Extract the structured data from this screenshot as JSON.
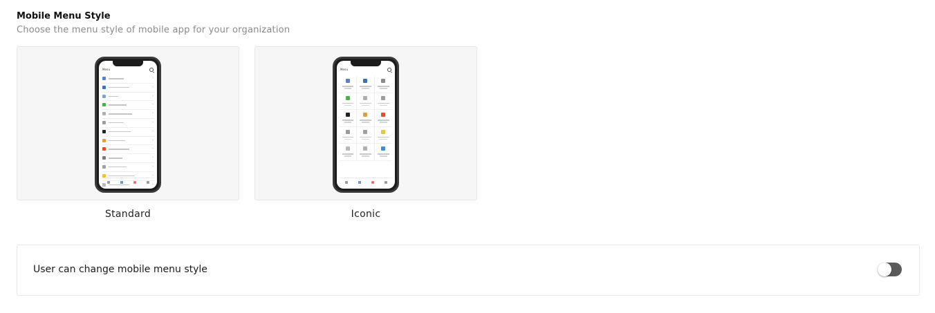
{
  "section": {
    "title": "Mobile Menu Style",
    "subtitle": "Choose the menu style of mobile app for your organization"
  },
  "options": [
    {
      "id": "standard",
      "label": "Standard",
      "selected": false
    },
    {
      "id": "iconic",
      "label": "Iconic",
      "selected": false
    }
  ],
  "preview": {
    "header_title": "Menu",
    "standard_icon_colors": [
      "#5b7fc7",
      "#3f6fb5",
      "#8aa0c8",
      "#4caf50",
      "#b0b0b0",
      "#9e9e9e",
      "#222222",
      "#e0a040",
      "#d9542b",
      "#7a7a7a",
      "#a0a0a0",
      "#e8c53a",
      "#b8b8b8"
    ],
    "iconic_icon_colors": [
      "#5b7fc7",
      "#3f6fb5",
      "#8a8a8a",
      "#4caf50",
      "#b0b0b0",
      "#9e9e9e",
      "#222222",
      "#e0a040",
      "#d9542b",
      "#9a9a9a",
      "#a0a0a0",
      "#e8c53a",
      "#b8b8b8",
      "#b0b0b0",
      "#3f8fd0"
    ]
  },
  "setting": {
    "label": "User can change mobile menu style",
    "enabled": false
  },
  "colors": {
    "toggle_off": "#5a5a5a",
    "card_bg": "#f6f6f6"
  }
}
